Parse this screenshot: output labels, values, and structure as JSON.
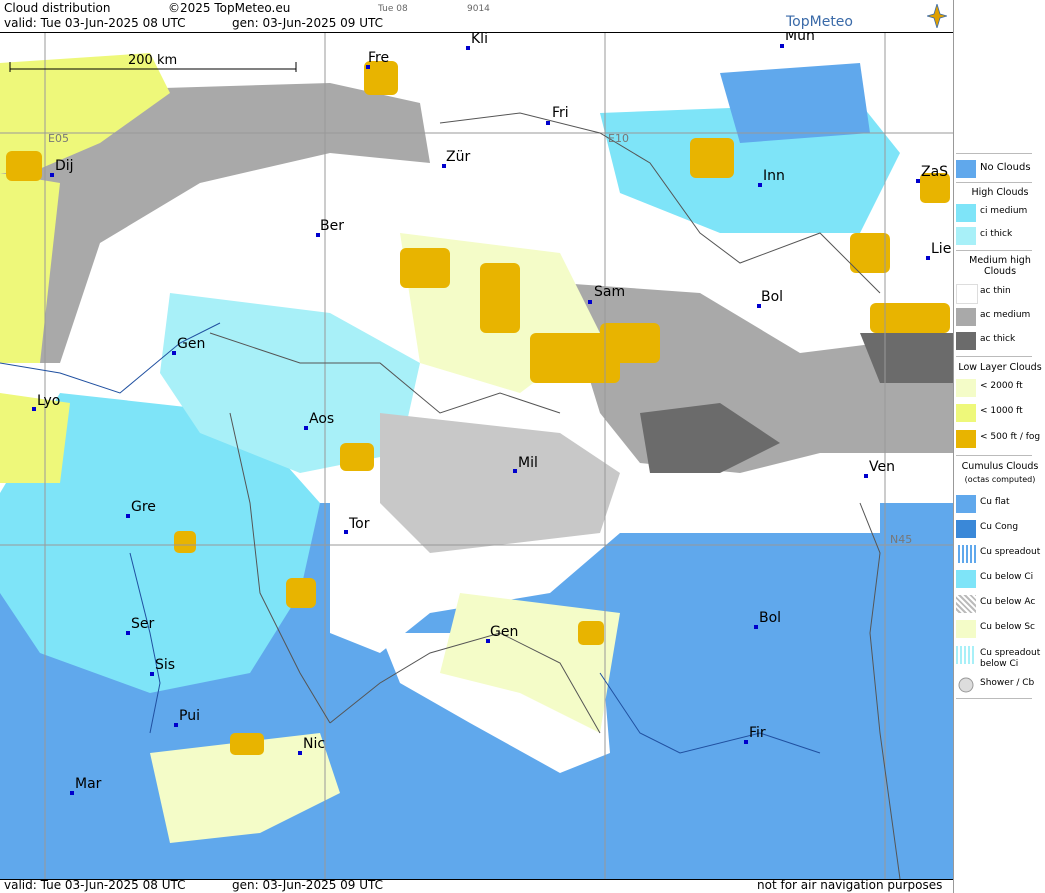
{
  "header": {
    "title": "Cloud distribution",
    "copyright": "©2025 TopMeteo.eu",
    "valid": "valid:  Tue  03-Jun-2025  08 UTC",
    "gen": "gen: 03-Jun-2025 09 UTC",
    "time_label": "Tue 08",
    "code": "9014",
    "logo": "TopMeteo"
  },
  "footer": {
    "valid": "valid:  Tue  03-Jun-2025  08 UTC",
    "gen": "gen: 03-Jun-2025 09 UTC",
    "disclaimer": "not for air navigation purposes"
  },
  "map": {
    "scale": "200 km",
    "grid_labels": [
      "E05",
      "E10",
      "N45"
    ],
    "cities": [
      "Kli",
      "Mün",
      "Fre",
      "Fri",
      "Dij",
      "Zür",
      "Inn",
      "ZaS",
      "Ber",
      "Lie",
      "Sam",
      "Bol",
      "Gen",
      "Lyo",
      "Aos",
      "Mil",
      "Ven",
      "Gre",
      "Tor",
      "Ser",
      "Gen",
      "Bol",
      "Sis",
      "Pui",
      "Nic",
      "Fir",
      "Mar"
    ]
  },
  "legend": {
    "no_clouds": "No Clouds",
    "high_head": "High Clouds",
    "ci_medium": "ci medium",
    "ci_thick": "ci thick",
    "medium_head": "Medium high Clouds",
    "ac_thin": "ac thin",
    "ac_medium": "ac medium",
    "ac_thick": "ac thick",
    "low_head": "Low Layer Clouds",
    "low_2000": "< 2000 ft",
    "low_1000": "< 1000 ft",
    "low_500": "< 500 ft / fog",
    "cu_head": "Cumulus Clouds",
    "cu_sub": "(octas computed)",
    "cu_flat": "Cu flat",
    "cu_cong": "Cu Cong",
    "cu_spread": "Cu spreadout",
    "cu_below_ci": "Cu below Ci",
    "cu_below_ac": "Cu below Ac",
    "cu_below_sc": "Cu below Sc",
    "cu_spread_ci": "Cu spreadout below Ci",
    "shower": "Shower / Cb"
  },
  "colors": {
    "no_clouds": "#60a8ec",
    "ci_medium": "#7ee4f8",
    "ci_thick": "#a8f0f8",
    "ac_medium": "#a9a9a9",
    "ac_thick": "#6b6b6b",
    "low_2000": "#f4fcc8",
    "low_1000": "#eef87a",
    "low_500": "#e8b400"
  }
}
